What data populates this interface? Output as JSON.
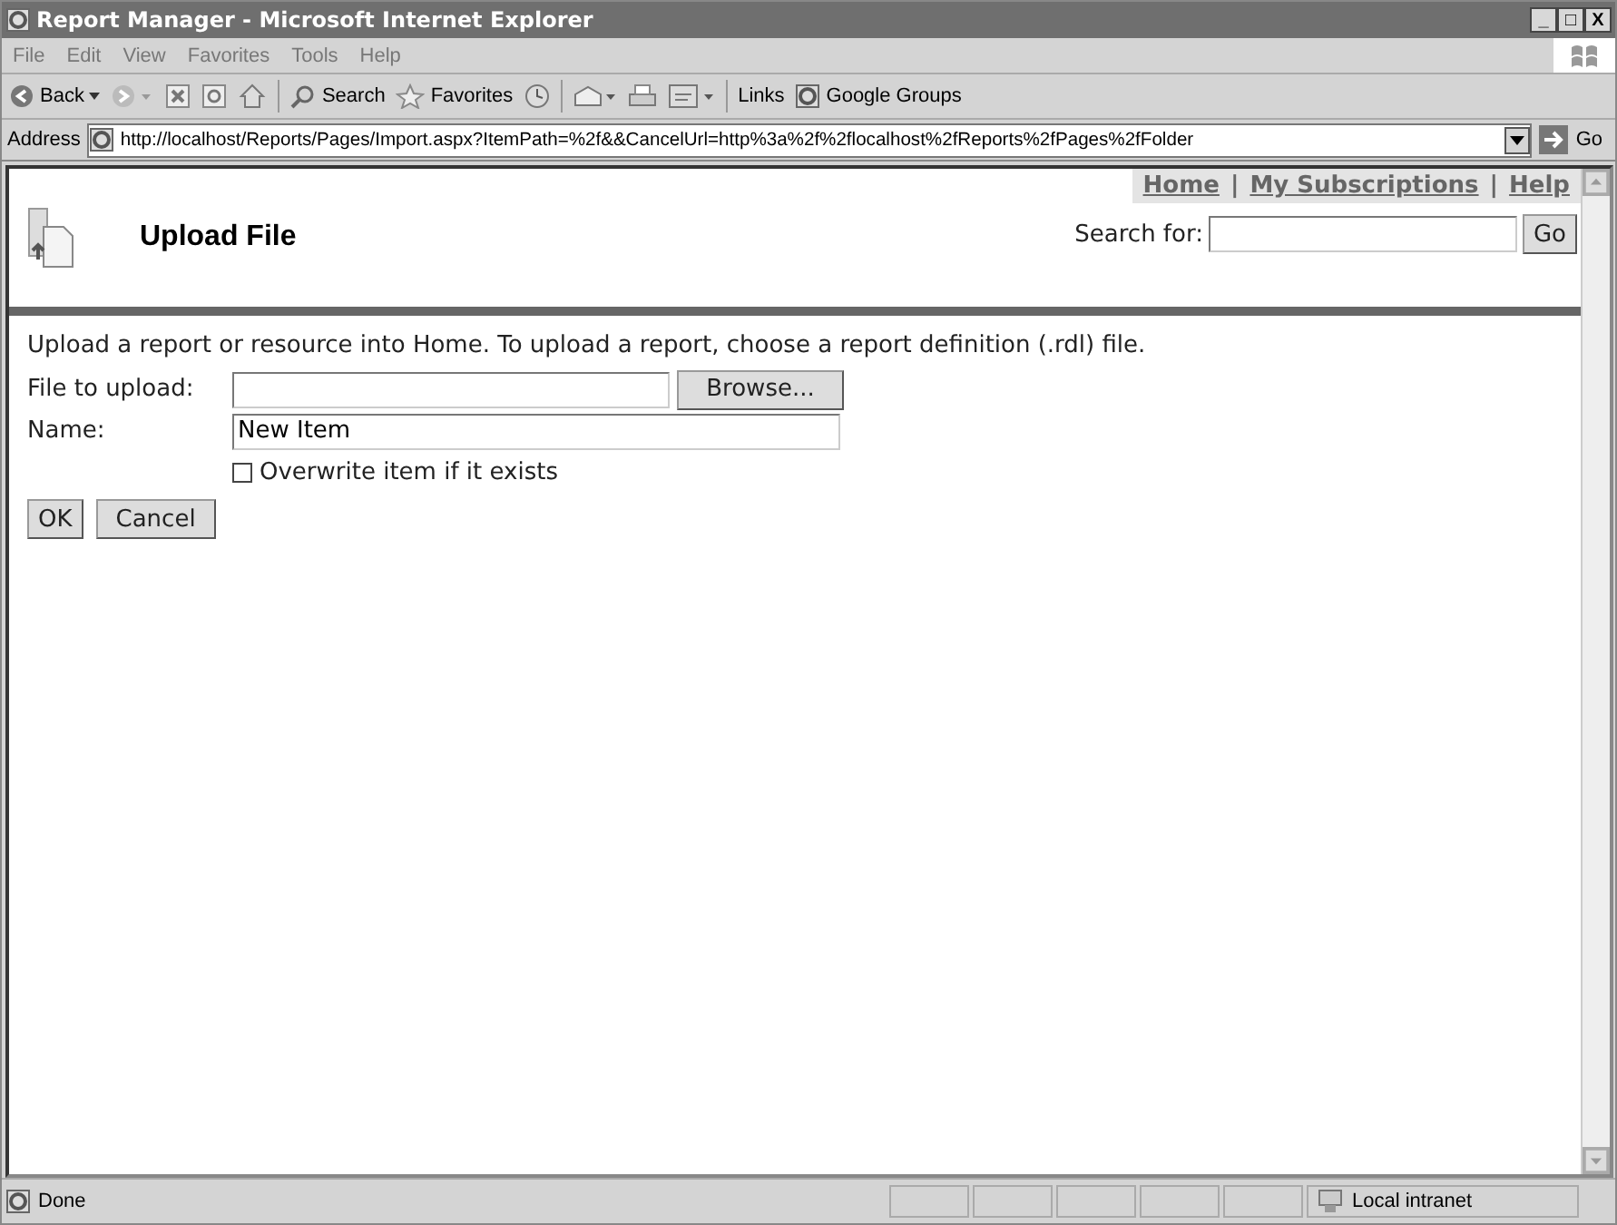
{
  "window": {
    "title": "Report Manager - Microsoft Internet Explorer",
    "controls": [
      "_",
      "□",
      "X"
    ]
  },
  "menu": [
    "File",
    "Edit",
    "View",
    "Favorites",
    "Tools",
    "Help"
  ],
  "toolbar": {
    "back": "Back",
    "search": "Search",
    "favorites": "Favorites",
    "links": "Links",
    "link_item": "Google Groups"
  },
  "address": {
    "label": "Address",
    "value": "http://localhost/Reports/Pages/Import.aspx?ItemPath=%2f&&CancelUrl=http%3a%2f%2flocalhost%2fReports%2fPages%2fFolder",
    "go": "Go"
  },
  "page": {
    "nav_links": [
      "Home",
      "My Subscriptions",
      "Help"
    ],
    "nav_separator": "|",
    "title": "Upload File",
    "search_label": "Search for:",
    "search_button": "Go",
    "intro": "Upload a report or resource into Home. To upload a report, choose a report definition (.rdl) file.",
    "file_label": "File to upload:",
    "browse": "Browse...",
    "name_label": "Name:",
    "name_value": "New Item",
    "overwrite": {
      "label": "Overwrite item if it exists",
      "checked": false
    },
    "buttons": [
      "OK",
      "Cancel"
    ]
  },
  "status_bar": {
    "status": "Done",
    "zone": "Local intranet"
  }
}
